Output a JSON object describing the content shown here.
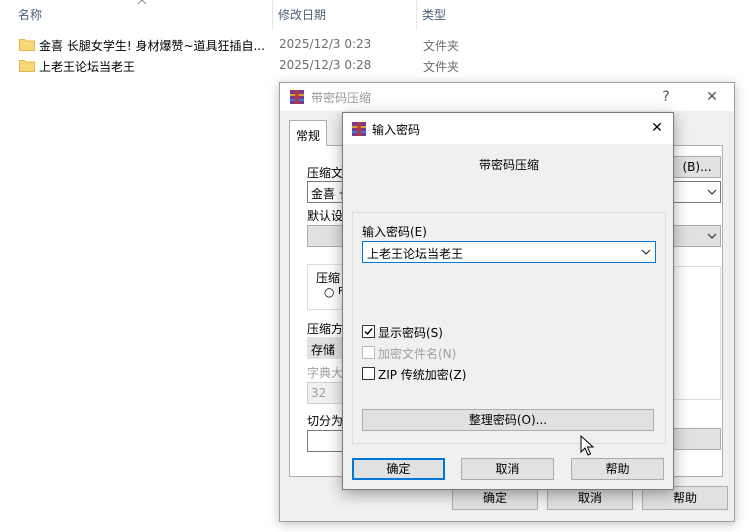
{
  "explorer": {
    "columns": {
      "name": "名称",
      "date": "修改日期",
      "type": "类型"
    },
    "rows": [
      {
        "name": "金喜 长腿女学生! 身材爆赞~道具狂插自...",
        "date": "2025/12/3 0:23",
        "type": "文件夹"
      },
      {
        "name": "上老王论坛当老王",
        "date": "2025/12/3 0:28",
        "type": "文件夹"
      }
    ]
  },
  "back_dialog": {
    "title": "带密码压缩",
    "help_glyph": "?",
    "close_glyph": "✕",
    "tab": "常规",
    "labels": {
      "compress_file": "压缩文",
      "archive_name": "金喜 长",
      "default_settings": "默认设",
      "compress_format": "压缩",
      "radio_r": "R",
      "compress_method": "压缩方",
      "method_value": "存储",
      "dict_size": "字典大",
      "dict_value": "32",
      "split_into": "切分为"
    },
    "browse_button": "(B)...",
    "ok": "确定",
    "cancel": "取消",
    "help": "帮助"
  },
  "front_dialog": {
    "title": "输入密码",
    "close_glyph": "✕",
    "heading": "带密码压缩",
    "password_label": "输入密码(E)",
    "password_value": "上老王论坛当老王",
    "checkboxes": [
      {
        "label": "显示密码(S)",
        "checked": true,
        "enabled": true
      },
      {
        "label": "加密文件名(N)",
        "checked": false,
        "enabled": false
      },
      {
        "label": "ZIP 传统加密(Z)",
        "checked": false,
        "enabled": true
      }
    ],
    "organize_button": "整理密码(O)...",
    "ok": "确定",
    "cancel": "取消",
    "help": "帮助"
  },
  "colors": {
    "accent": "#0078d7",
    "folder": "#f8d775",
    "header_text": "#4c607a"
  }
}
